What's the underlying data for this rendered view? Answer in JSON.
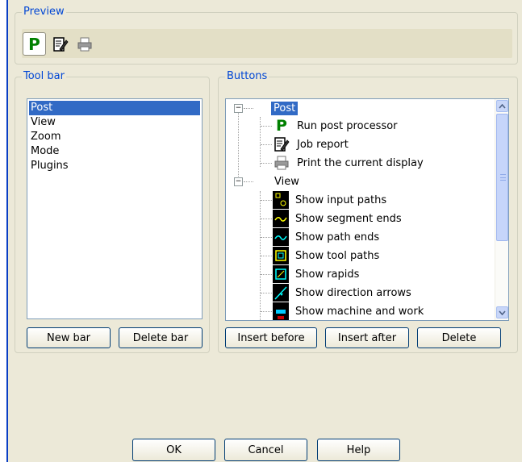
{
  "preview": {
    "legend": "Preview",
    "icons": [
      "post-processor-icon",
      "job-report-icon",
      "print-icon"
    ]
  },
  "toolbar": {
    "legend": "Tool bar",
    "items": [
      "Post",
      "View",
      "Zoom",
      "Mode",
      "Plugins"
    ],
    "selected": "Post",
    "new_bar": "New bar",
    "delete_bar": "Delete bar"
  },
  "buttons": {
    "legend": "Buttons",
    "tree": [
      {
        "label": "Post",
        "type": "group",
        "icon": "minus-box"
      },
      {
        "label": "Run post processor",
        "icon": "post-processor-icon"
      },
      {
        "label": "Job report",
        "icon": "job-report-icon"
      },
      {
        "label": "Print the current display",
        "icon": "print-icon"
      },
      {
        "label": "View",
        "type": "group",
        "icon": "minus-box"
      },
      {
        "label": "Show input paths",
        "icon": "input-paths-icon"
      },
      {
        "label": "Show segment ends",
        "icon": "segment-ends-icon"
      },
      {
        "label": "Show path ends",
        "icon": "path-ends-icon"
      },
      {
        "label": "Show tool paths",
        "icon": "tool-paths-icon"
      },
      {
        "label": "Show rapids",
        "icon": "rapids-icon"
      },
      {
        "label": "Show direction arrows",
        "icon": "direction-arrows-icon"
      },
      {
        "label": "Show machine and work",
        "icon": "machine-work-icon"
      }
    ],
    "insert_before": "Insert before",
    "insert_after": "Insert after",
    "delete": "Delete"
  },
  "footer": {
    "ok": "OK",
    "cancel": "Cancel",
    "help": "Help"
  },
  "colors": {
    "accent": "#316ac5",
    "legend": "#0046d5",
    "dialog_bg": "#ece9d8",
    "post_green": "#008000"
  }
}
